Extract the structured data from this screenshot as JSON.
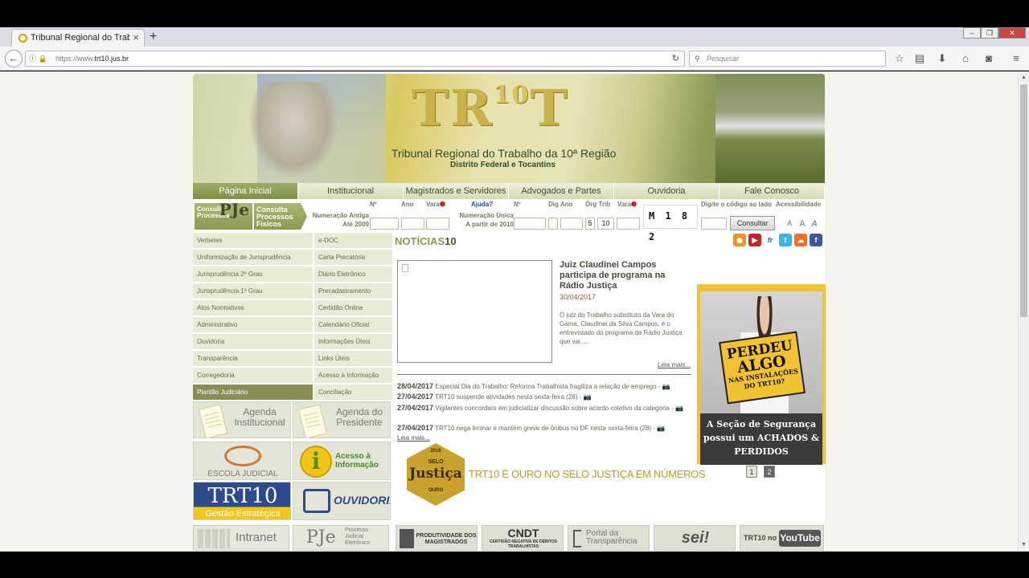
{
  "browser": {
    "tab_title": "Tribunal Regional do Trabalh",
    "tab_close": "×",
    "new_tab": "+",
    "url_prefix": "https://www.",
    "url_domain": "trt10.jus.br",
    "search_placeholder": "Pesquisar"
  },
  "banner": {
    "logo_t": "T",
    "logo_r": "R",
    "logo_10": "10",
    "logo_t2": "T",
    "title": "Tribunal Regional do Trabalho da 10ª Região",
    "subtitle": "Distrito Federal e Tocantins"
  },
  "menu": [
    {
      "label": "Página Inicial"
    },
    {
      "label": "Institucional"
    },
    {
      "label": "Magistrados e Servidores"
    },
    {
      "label": "Advogados e Partes"
    },
    {
      "label": "Ouvidoria"
    },
    {
      "label": "Fale Conosco"
    }
  ],
  "consulta": {
    "pje_btn_label": "Consulta Processos",
    "pje_btn_big": "PJe",
    "fisicos_btn_label": "Consulta Processos Físicos",
    "antiga_label": "Numeração Antiga Até 2009",
    "unica_label_1": "Numeração Única",
    "unica_label_2": "A partir de 2010",
    "h_no": "Nº",
    "h_ano": "Ano",
    "h_vara": "Vara",
    "h_ajuda": "Ajuda?",
    "h_no2": "Nº",
    "h_dig_ano": "Dig Ano",
    "h_org_trib": "Órg Trib",
    "h_vara2": "Vara",
    "val_org": "5",
    "val_trib": "10",
    "captcha_text": "M 1 8 2",
    "captcha_label": "Digite o código ao lado",
    "consultar_label": "Consultar",
    "acessibilidade_label": "Acessibilidade",
    "acc_a1": "A",
    "acc_a2": "A",
    "acc_a3": "A"
  },
  "leftnav_col1": [
    {
      "label": "Verbetes"
    },
    {
      "label": "Uniformização de Jurisprudência"
    },
    {
      "label": "Jurisprudência 2º Grau"
    },
    {
      "label": "Jurisprudência 1º Grau"
    },
    {
      "label": "Atos Normativos"
    },
    {
      "label": "Administrativo"
    },
    {
      "label": "Ouvidoria"
    },
    {
      "label": "Transparência"
    },
    {
      "label": "Corregedoria"
    },
    {
      "label": "Plantão Judiciário"
    }
  ],
  "leftnav_col2": [
    {
      "label": "e-DOC"
    },
    {
      "label": "Carta Precatória"
    },
    {
      "label": "Diário Eletrônico"
    },
    {
      "label": "Precadastramento"
    },
    {
      "label": "Certidão Online"
    },
    {
      "label": "Calendário Oficial"
    },
    {
      "label": "Informações Úteis"
    },
    {
      "label": "Links Úteis"
    },
    {
      "label": "Acesso à Informação"
    },
    {
      "label": "Conciliação"
    }
  ],
  "tiles": {
    "agenda_inst_1": "Agenda",
    "agenda_inst_2": "Institucional",
    "agenda_pres_1": "Agenda do",
    "agenda_pres_2": "Presidente",
    "escola": "ESCOLA JUDICIAL",
    "acesso_1": "Acesso à",
    "acesso_2": "Informação",
    "gestao_logo": "TRT10",
    "gestao_sub": "Gestão Estratégica",
    "ouvidoria": "OUVIDORIA"
  },
  "news": {
    "heading_1": "NOTÍCIAS",
    "heading_2": "10",
    "feature_title": "Juiz Claudinei Campos participa de programa na Rádio Justiça",
    "feature_date": "30/04/2017",
    "feature_text": "O juiz do Trabalho substituto da Vara do Gama, Claudinei da Silva Campos, é o entrevistado do programa da Rádio Justiça que vai ....",
    "feature_more": "Leia mais...",
    "items": [
      {
        "date": "28/04/2017",
        "text": "Especial Dia do Trabalho: Reforma Trabalhista fragiliza a relação de emprego - "
      },
      {
        "date": "27/04/2017",
        "text": "TRT10 suspende atividades nesta sexta-feira (28) - "
      },
      {
        "date": "27/04/2017",
        "text": "Vigilantes concordam em judicializar discussão sobre acordo coletivo da categoria - "
      },
      {
        "date": "27/04/2017",
        "text": "TRT10 nega liminar e mantém greve de ônibus no DF nesta sexta-feira (28) - "
      }
    ],
    "more": "Leia mais..."
  },
  "selo": {
    "badge_year": "2016",
    "badge_top": "SELO",
    "badge_main": "Justiça",
    "badge_level": "OURO",
    "text": "TRT10 É OURO NO SELO JUSTIÇA EM NÚMEROS"
  },
  "ad": {
    "sign_1": "PERDEU",
    "sign_2": "ALGO",
    "sign_3": "NAS INSTALAÇÕES DO TRT10?",
    "caption": "A Seção de Segurança possui um ACHADOS & PERDIDOS",
    "page_1": "1",
    "page_2": "2"
  },
  "bottom_links": {
    "intranet": "Intranet",
    "pje_big": "PJe",
    "pje_small": "Processo Judicial Eletrônico",
    "produtividade": "PRODUTIVIDADE DOS MAGISTRADOS",
    "cndt": "CNDT",
    "cndt_small": "CERTIDÃO NEGATIVA DE DÉBITOS TRABALHISTAS",
    "portal": "Portal da Transparência",
    "sei": "sei!",
    "youtube_pre": "TRT10 no",
    "youtube": "YouTube"
  },
  "colors": {
    "menu_green": "#8a9a50",
    "ad_yellow": "#f1c232",
    "news_date": "#7d6a2a"
  }
}
